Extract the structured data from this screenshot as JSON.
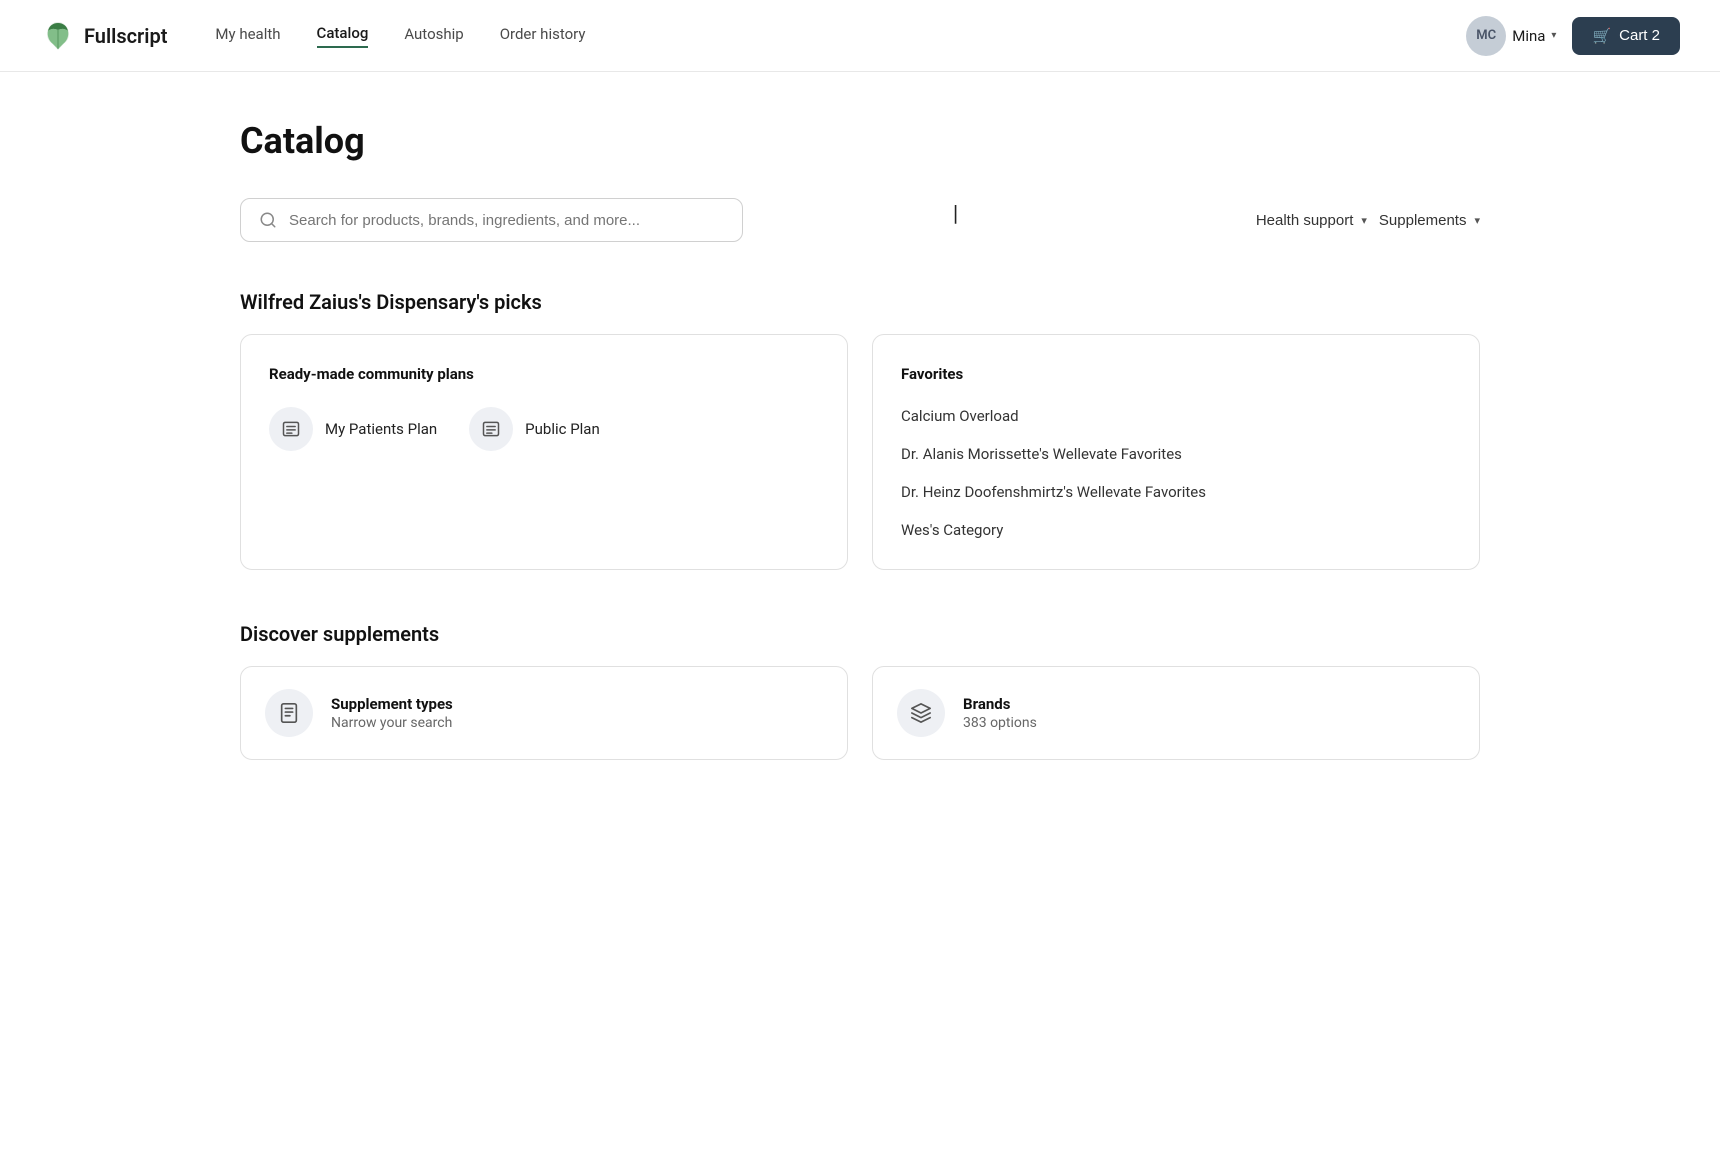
{
  "logo": {
    "text": "Fullscript"
  },
  "nav": {
    "links": [
      {
        "label": "My health",
        "active": false
      },
      {
        "label": "Catalog",
        "active": true
      },
      {
        "label": "Autoship",
        "active": false
      },
      {
        "label": "Order history",
        "active": false
      }
    ],
    "user": {
      "initials": "MC",
      "name": "Mina"
    },
    "cart": {
      "label": "Cart 2"
    }
  },
  "page": {
    "title": "Catalog"
  },
  "search": {
    "placeholder": "Search for products, brands, ingredients, and more..."
  },
  "filters": [
    {
      "label": "Health support"
    },
    {
      "label": "Supplements"
    }
  ],
  "picks": {
    "section_title": "Wilfred Zaius's Dispensary's picks",
    "community_plans": {
      "card_title": "Ready-made community plans",
      "items": [
        {
          "label": "My Patients Plan"
        },
        {
          "label": "Public Plan"
        }
      ]
    },
    "favorites": {
      "card_title": "Favorites",
      "items": [
        "Calcium Overload",
        "Dr. Alanis Morissette's Wellevate Favorites",
        "Dr. Heinz Doofenshmirtz's Wellevate Favorites",
        "Wes's Category"
      ]
    }
  },
  "discover": {
    "section_title": "Discover supplements",
    "cards": [
      {
        "name": "Supplement types",
        "sub": "Narrow your search"
      },
      {
        "name": "Brands",
        "sub": "383 options"
      }
    ]
  }
}
